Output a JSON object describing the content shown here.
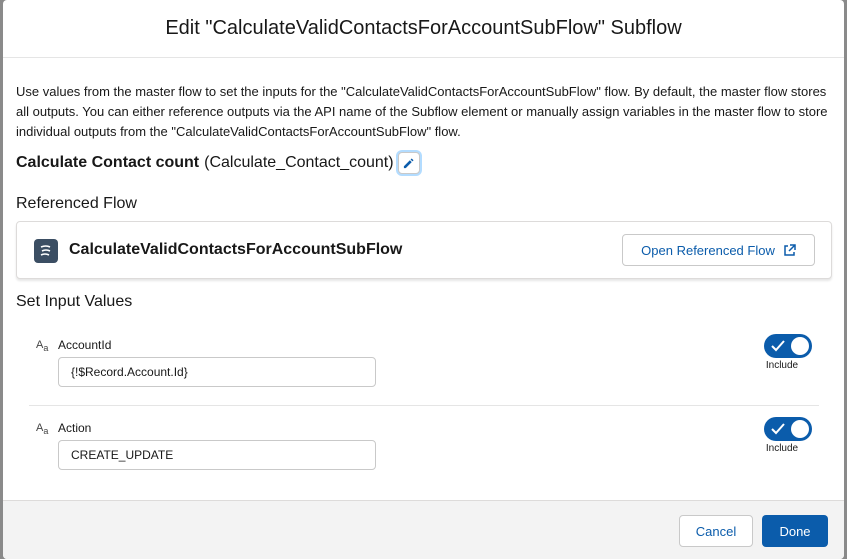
{
  "modal": {
    "title": "Edit \"CalculateValidContactsForAccountSubFlow\" Subflow",
    "description": "Use values from the master flow to set the inputs for the \"CalculateValidContactsForAccountSubFlow\" flow. By default, the master flow stores all outputs. You can either reference outputs via the API name of the Subflow element or manually assign variables in the master flow to store individual outputs from the \"CalculateValidContactsForAccountSubFlow\" flow.",
    "element_label": "Calculate Contact count",
    "element_api_name": "(Calculate_Contact_count)"
  },
  "referenced_flow": {
    "section_title": "Referenced Flow",
    "flow_name": "CalculateValidContactsForAccountSubFlow",
    "open_button_label": "Open Referenced Flow",
    "icon": "flow-icon"
  },
  "inputs": {
    "section_title": "Set Input Values",
    "items": [
      {
        "label": "AccountId",
        "value": "{!$Record.Account.Id}",
        "include_label": "Include",
        "include_on": true,
        "type_icon": "text-type-icon"
      },
      {
        "label": "Action",
        "value": "CREATE_UPDATE",
        "include_label": "Include",
        "include_on": true,
        "type_icon": "text-type-icon"
      }
    ]
  },
  "footer": {
    "cancel_label": "Cancel",
    "done_label": "Done"
  },
  "colors": {
    "brand": "#0b5cab",
    "backdrop": "#8a8a8a",
    "footer_bg": "#f3f3f3"
  }
}
